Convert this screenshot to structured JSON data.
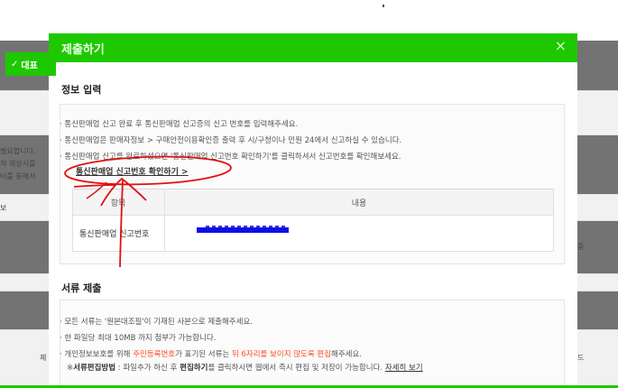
{
  "modal": {
    "title": "제출하기",
    "close_label": "×",
    "badge": "대표"
  },
  "background": {
    "line1": "필요합니다. ",
    "line2": "적 재상사를 ",
    "line3": "터를 통해서 ",
    "side_left": "보",
    "side_right": "증",
    "side_left2": "제",
    "side_right2": "드"
  },
  "info_section": {
    "title": "정보 입력",
    "guides": [
      "· 통신판매업 신고 완료 후 통신판매업 신고증의 신고 번호를 입력해주세요.",
      "· 통신판매업은 판매자정보 > 구매안전이용확인증 출력 후 시/구청이나 민원 24에서 신고하실 수 있습니다.",
      "· 통신판매업 신고를 완료하셨으면 '통신판매업 신고번호 확인하기'를 클릭하셔서 신고번호를 확인해보세요."
    ],
    "verify_link": "통신판매업 신고번호 확인하기 >",
    "table": {
      "header_item": "항목",
      "header_content": "내용",
      "row_label": "통신판매업 신고번호"
    }
  },
  "doc_section": {
    "title": "서류 제출",
    "guide1": "· 모든 서류는 '원본대조필'이 기재된 사본으로 제출해주세요.",
    "guide2": "· 한 파일당 최대 10MB 까지 첨부가 가능합니다.",
    "guide3_a": "· 개인정보보호를 위해 ",
    "guide3_red1": "주민등록번호",
    "guide3_b": "가 표기된 서류는 ",
    "guide3_red2": "뒤 6자리를 보이지 않도록 편집",
    "guide3_c": "해주세요.",
    "guide4_a": "※",
    "guide4_b": "서류편집방법",
    "guide4_c": " : 파일추가 하신 후 ",
    "guide4_d": "편집하기",
    "guide4_e": "를 클릭하시면 웹에서 즉시 편집 및 저장이 가능합니다. ",
    "guide4_link": "자세히 보기"
  },
  "colors": {
    "brand_green": "#1ec800",
    "annotation_red": "#e01010",
    "masked_blue": "#0a10e8"
  }
}
